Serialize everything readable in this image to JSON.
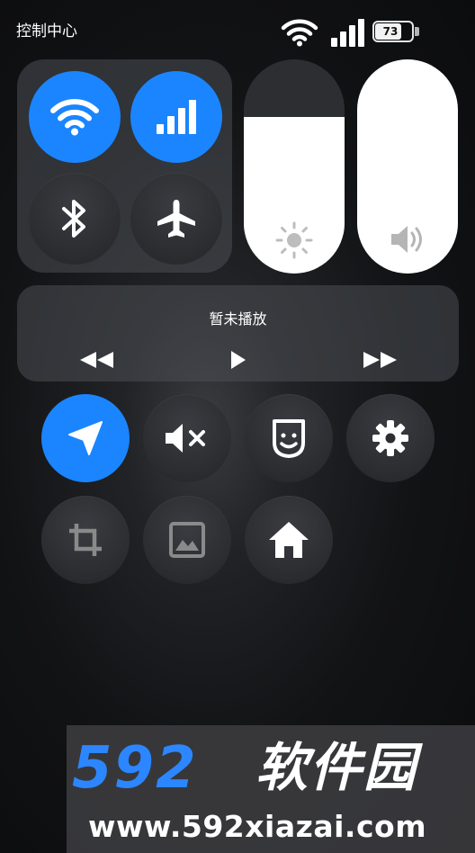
{
  "status_bar": {
    "title": "控制中心",
    "battery_level": "73",
    "battery_fraction": 0.73
  },
  "connectivity": {
    "wifi": {
      "icon": "wifi-icon",
      "active": true
    },
    "cellular": {
      "icon": "cellular-signal-icon",
      "active": true
    },
    "bluetooth": {
      "icon": "bluetooth-icon",
      "active": false
    },
    "airplane": {
      "icon": "airplane-icon",
      "active": false
    }
  },
  "sliders": {
    "brightness": {
      "icon": "brightness-icon",
      "level": 0.73
    },
    "volume": {
      "icon": "volume-icon",
      "level": 1.0
    }
  },
  "media": {
    "title": "暂未播放",
    "prev_icon": "rewind-icon",
    "play_icon": "play-icon",
    "next_icon": "fast-forward-icon"
  },
  "shortcuts": [
    {
      "icon": "location-arrow-icon",
      "active": true
    },
    {
      "icon": "mute-icon",
      "active": false
    },
    {
      "icon": "face-icon",
      "active": false
    },
    {
      "icon": "settings-gear-icon",
      "active": false
    },
    {
      "icon": "crop-icon",
      "active": false
    },
    {
      "icon": "gallery-icon",
      "active": false
    },
    {
      "icon": "home-icon",
      "active": false
    }
  ],
  "watermark": {
    "brand_number": "592",
    "brand_name": "软件园",
    "url": "www.592xiazai.com"
  },
  "colors": {
    "accent": "#1a85ff",
    "panel": "#4b4e54",
    "button_dark": "#2c2e32"
  }
}
